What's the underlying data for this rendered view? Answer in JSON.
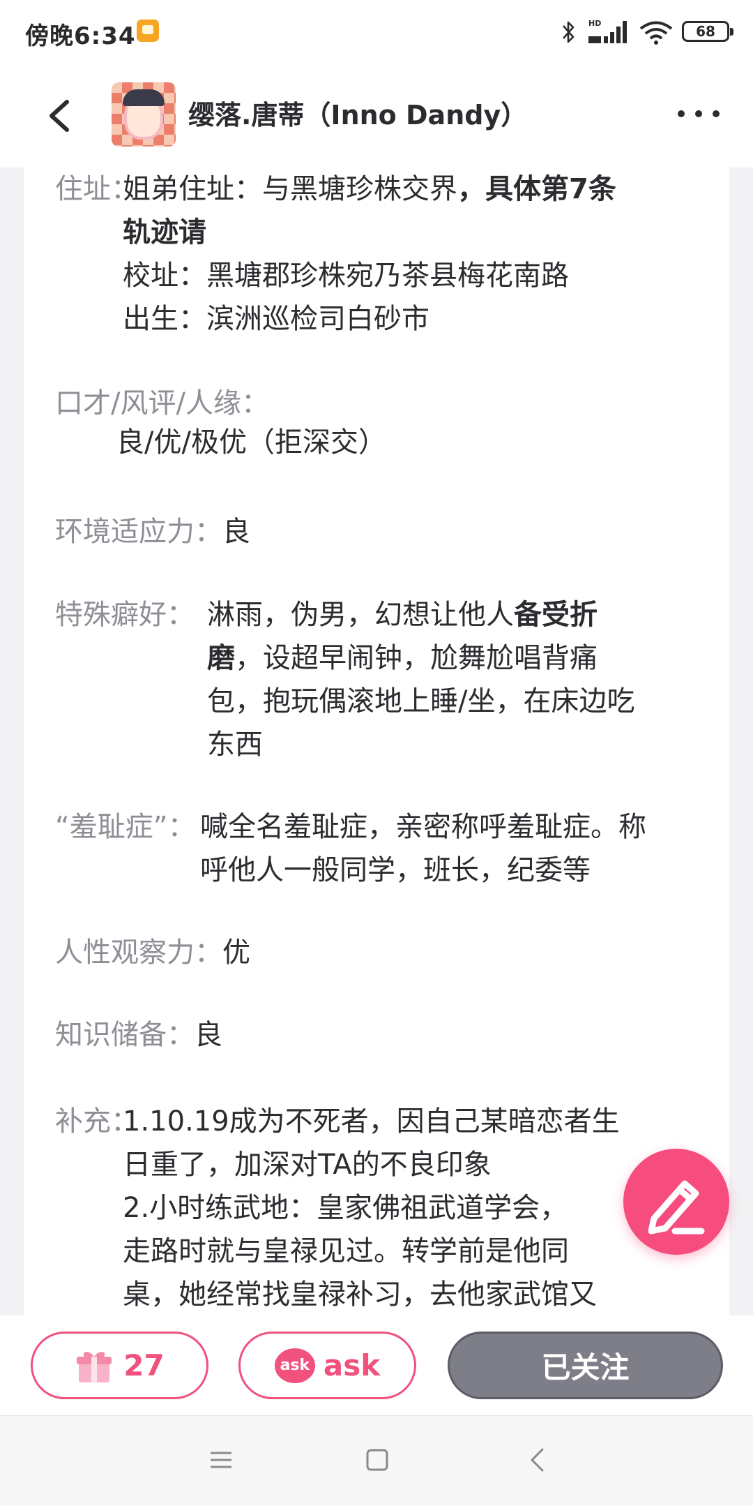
{
  "status_bar": {
    "time": "傍晚6:34",
    "battery": "68"
  },
  "header": {
    "title": "缨落.唐蒂（Inno Dandy）"
  },
  "profile": {
    "address": {
      "label": "住址：",
      "lines": [
        {
          "text": "姐弟住址：与黑塘珍株交界",
          "bold": "，具体第7条"
        },
        {
          "text": "",
          "bold": "轨迹请"
        },
        {
          "text": "校址：黑塘郡珍株宛乃茶县梅花南路"
        },
        {
          "text": "出生：滨洲巡检司白砂市"
        }
      ]
    },
    "eloquence": {
      "label": "口才/风评/人缘：",
      "value": "良/优/极优（拒深交）"
    },
    "adaptability": {
      "label": "环境适应力：",
      "value": "良"
    },
    "hobbies": {
      "label": "特殊癖好：",
      "line1_normal": "淋雨，伪男，幻想让他人",
      "line1_bold": "备受折",
      "line2_bold": "磨",
      "line2_normal": "，设超早闹钟，尬舞尬唱背痛",
      "line3": "包，抱玩偶滚地上睡/坐，在床边吃",
      "line4": "东西"
    },
    "shame": {
      "label": "“羞耻症”：",
      "line1": "喊全名羞耻症，亲密称呼羞耻症。称",
      "line2": "呼他人一般同学，班长，纪委等"
    },
    "insight": {
      "label": "人性观察力：",
      "value": "优"
    },
    "knowledge": {
      "label": "知识储备：",
      "value": "良"
    },
    "supplement": {
      "label": "补充：",
      "lines": [
        "1.10.19成为不死者，因自己某暗恋者生",
        "日重了，加深对TA的不良印象",
        "2.小时练武地：皇家佛祖武道学会，",
        "走路时就与皇禄见过。转学前是他同",
        "桌，她经常找皇禄补习，去他家武馆又"
      ]
    }
  },
  "actions": {
    "gift_count": "27",
    "ask_icon_text": "ask",
    "ask_label": "ask",
    "follow_label": "已关注"
  },
  "colors": {
    "accent": "#f0517d",
    "fab": "#f64c7e",
    "followed_button": "#7e7e88",
    "label_gray": "#8e8e96"
  },
  "icons": {
    "status": [
      "notification-icon",
      "bluetooth-icon",
      "signal-icon",
      "wifi-icon",
      "battery-icon"
    ],
    "header": [
      "back-icon",
      "more-icon"
    ],
    "actions": [
      "gift-icon",
      "ask-icon",
      "edit-icon"
    ],
    "nav": [
      "menu-icon",
      "home-icon",
      "back-icon"
    ]
  }
}
